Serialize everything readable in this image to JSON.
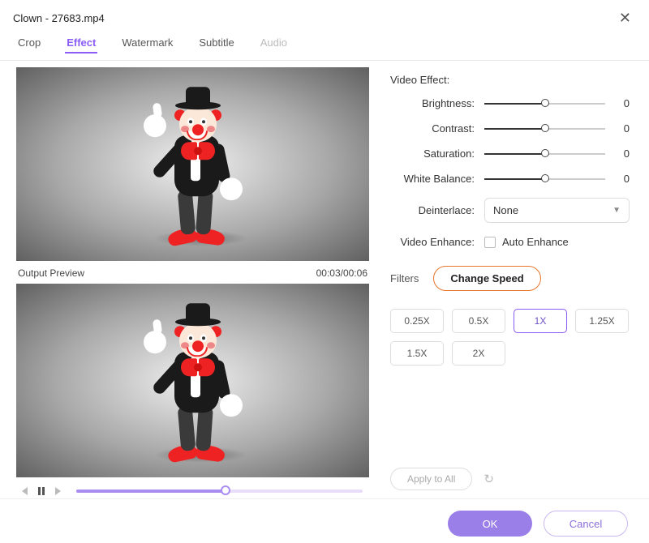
{
  "title": "Clown - 27683.mp4",
  "tabs": [
    "Crop",
    "Effect",
    "Watermark",
    "Subtitle",
    "Audio"
  ],
  "activeTab": "Effect",
  "disabledTab": "Audio",
  "preview": {
    "label": "Output Preview",
    "time": "00:03/00:06",
    "progressPct": 52
  },
  "effect": {
    "heading": "Video Effect:",
    "sliders": {
      "brightness": {
        "label": "Brightness:",
        "value": 0,
        "pct": 50
      },
      "contrast": {
        "label": "Contrast:",
        "value": 0,
        "pct": 50
      },
      "saturation": {
        "label": "Saturation:",
        "value": 0,
        "pct": 50
      },
      "whitebalance": {
        "label": "White Balance:",
        "value": 0,
        "pct": 50
      }
    },
    "deinterlace": {
      "label": "Deinterlace:",
      "value": "None"
    },
    "enhance": {
      "label": "Video Enhance:",
      "checkbox": "Auto Enhance",
      "checked": false
    }
  },
  "subtabs": {
    "filters": "Filters",
    "speed": "Change Speed",
    "active": "speed"
  },
  "speeds": [
    "0.25X",
    "0.5X",
    "1X",
    "1.25X",
    "1.5X",
    "2X"
  ],
  "activeSpeed": "1X",
  "applyAll": "Apply to All",
  "buttons": {
    "ok": "OK",
    "cancel": "Cancel"
  }
}
